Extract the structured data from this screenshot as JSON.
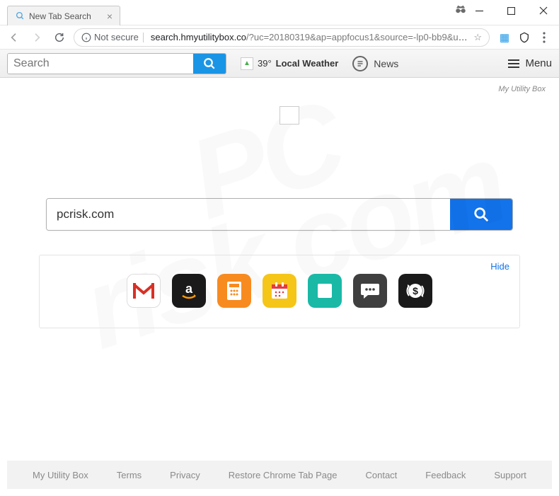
{
  "window": {
    "tab_title": "New Tab Search"
  },
  "addressbar": {
    "security_label": "Not secure",
    "url_domain": "search.hmyutilitybox.co",
    "url_path": "/?uc=20180319&ap=appfocus1&source=-lp0-bb9&uid=01f1a93d-6..."
  },
  "toolbar": {
    "search_placeholder": "Search",
    "weather_temp": "39°",
    "weather_label": "Local Weather",
    "news_label": "News",
    "menu_label": "Menu"
  },
  "brand": {
    "name": "My Utility Box"
  },
  "search": {
    "value": "pcrisk.com"
  },
  "tiles": {
    "hide_label": "Hide",
    "items": [
      {
        "name": "gmail-tile",
        "bg": "#ffffff"
      },
      {
        "name": "amazon-tile",
        "bg": "#1a1a1a"
      },
      {
        "name": "calculator-tile",
        "bg": "#f78b1f"
      },
      {
        "name": "calendar-tile",
        "bg": "#f5c518"
      },
      {
        "name": "app-tile",
        "bg": "#19b9a6"
      },
      {
        "name": "chat-tile",
        "bg": "#3f3f3f"
      },
      {
        "name": "finance-tile",
        "bg": "#1a1a1a"
      }
    ]
  },
  "footer": {
    "items": [
      "My Utility Box",
      "Terms",
      "Privacy",
      "Restore Chrome Tab Page",
      "Contact",
      "Feedback",
      "Support"
    ]
  },
  "colors": {
    "primary": "#1273eb",
    "search_btn": "#1a95e5"
  }
}
